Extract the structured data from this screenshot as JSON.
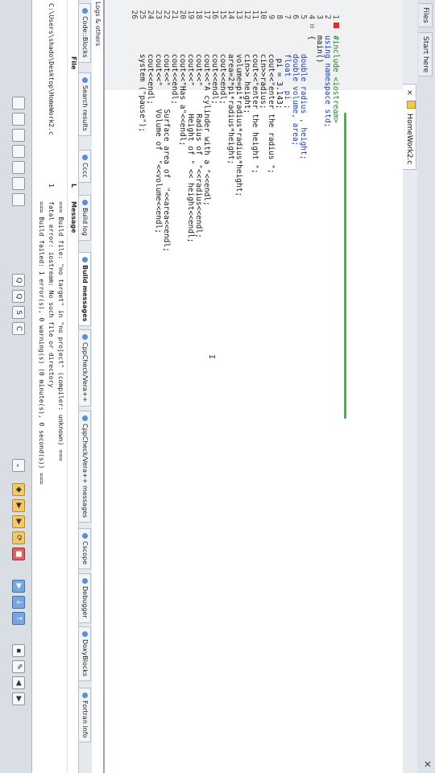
{
  "left_panel": {
    "tab_start": "Start here",
    "tab_files": "Files",
    "close": "×"
  },
  "editor_tab": {
    "label": "HomeWork2.c",
    "close": "×"
  },
  "code_lines": [
    {
      "n": "1",
      "t": "#include <iostream>"
    },
    {
      "n": "2",
      "t": "using namespace std;"
    },
    {
      "n": "3",
      "t": "main()"
    },
    {
      "n": "4",
      "t": "{"
    },
    {
      "n": "5",
      "t": "    double radius , height;"
    },
    {
      "n": "6",
      "t": "    double volume, area;"
    },
    {
      "n": "7",
      "t": "    float   pi ;"
    },
    {
      "n": "8",
      "t": "     pi = 3.143;"
    },
    {
      "n": "9",
      "t": "    cout<<\"enter the radius \";"
    },
    {
      "n": "10",
      "t": "    cin>>radius;"
    },
    {
      "n": "11",
      "t": "    cout<<\"enter the height \";"
    },
    {
      "n": "12",
      "t": "    cin>> height;"
    },
    {
      "n": "13",
      "t": "    volume=pi*radius*radius*height;"
    },
    {
      "n": "14",
      "t": "    area=2*pi*radius*height;"
    },
    {
      "n": "15",
      "t": "    cout<<endl;"
    },
    {
      "n": "16",
      "t": "    cout<<endl;"
    },
    {
      "n": "17",
      "t": "    cout<<\"A cylinder with a \"<<endl;"
    },
    {
      "n": "18",
      "t": "    cout<<\"      Radius of  \"<<radius<<endl;"
    },
    {
      "n": "19",
      "t": "    cout<<\"      Height of \" << height<<endl;"
    },
    {
      "n": "20",
      "t": "    cout<<\"Has a\"<<endl;"
    },
    {
      "n": "21",
      "t": "    cout<<endl;"
    },
    {
      "n": "22",
      "t": "    cout<<\"     Surface area of  \"<<area<<endl;"
    },
    {
      "n": "23",
      "t": "    cout<<\"     Volume of  \"<<volume<<endl;"
    },
    {
      "n": "24",
      "t": "    cout<<endl;"
    },
    {
      "n": "25",
      "t": "    system (\"pause\");"
    },
    {
      "n": "26",
      "t": ""
    }
  ],
  "logs": {
    "title": "Logs & others",
    "tabs": [
      "Code::Blocks",
      "Search results",
      "Cccc",
      "Build log",
      "Build messages",
      "CppCheck/Vera++",
      "CppCheck/Vera++ messages",
      "Cscope",
      "Debugger",
      "DoxyBlocks",
      "Fortran info"
    ],
    "active_tab": "Build messages",
    "col_file": "File",
    "col_line": "L",
    "col_message": "Message",
    "rows": [
      {
        "file": "",
        "line": "",
        "msg": "=== Build file: \"no target\" in \"no project\" (compiler: unknown) ==="
      },
      {
        "file": "C:\\Users\\shado\\Desktop\\HomeWork2.c",
        "line": "1",
        "msg": "fatal error: iostream: No such file or directory"
      },
      {
        "file": "",
        "line": "",
        "msg": "=== Build failed: 1 error(s), 0 warning(s) (0 minute(s), 0 second(s)) ==="
      }
    ]
  }
}
